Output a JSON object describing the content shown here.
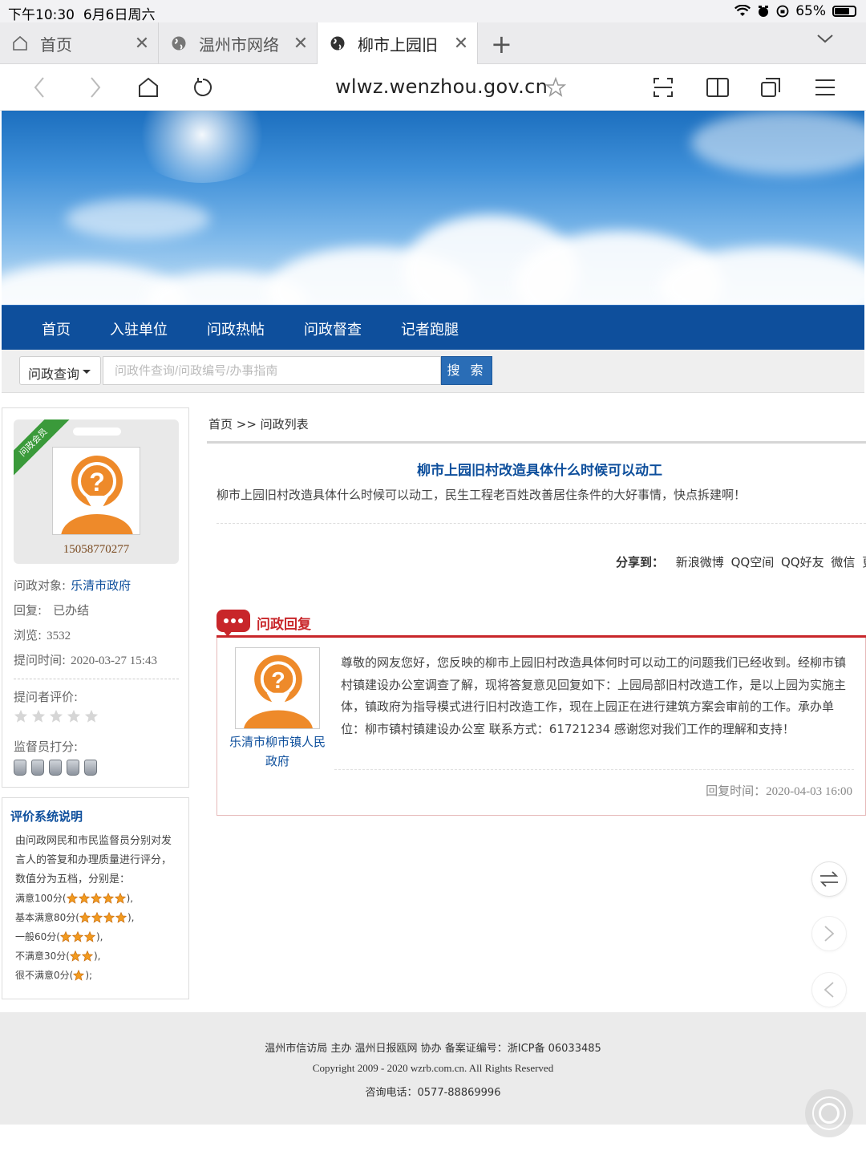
{
  "status_bar": {
    "time": "下午10:30",
    "date": "6月6日周六",
    "battery": "65%"
  },
  "tabs": [
    {
      "label": "首页",
      "icon": "home-icon",
      "active": false
    },
    {
      "label": "温州市网络",
      "icon": "globe-icon",
      "active": false
    },
    {
      "label": "柳市上园旧",
      "icon": "globe-icon",
      "active": true
    }
  ],
  "address": {
    "url": "wlwz.wenzhou.gov.cn"
  },
  "main_nav": [
    "首页",
    "入驻单位",
    "问政热帖",
    "问政督查",
    "记者跑腿"
  ],
  "search": {
    "select": "问政查询",
    "placeholder": "问政件查询/问政编号/办事指南",
    "button": "搜 索"
  },
  "asker": {
    "ribbon": "问政会员",
    "phone": "15058770277",
    "target_label": "问政对象:",
    "target_value": "乐清市政府",
    "reply_label": "回复:",
    "reply_value": "已办结",
    "views_label": "浏览:",
    "views_value": "3532",
    "time_label": "提问时间:",
    "time_value": "2020-03-27 15:43",
    "asker_rating_label": "提问者评价:",
    "supervisor_label": "监督员打分:"
  },
  "rules": {
    "title": "评价系统说明",
    "desc": "由问政网民和市民监督员分别对发言人的答复和办理质量进行评分，数值分为五档，分别是：",
    "levels": [
      {
        "label": "满意100分(",
        "stars": 5,
        "suffix": "),"
      },
      {
        "label": "基本满意80分(",
        "stars": 4,
        "suffix": "),"
      },
      {
        "label": "一般60分(",
        "stars": 3,
        "suffix": "),"
      },
      {
        "label": "不满意30分(",
        "stars": 2,
        "suffix": "),"
      },
      {
        "label": "很不满意0分(",
        "stars": 1,
        "suffix": ");"
      }
    ]
  },
  "content": {
    "breadcrumb": "首页 >> 问政列表",
    "title": "柳市上园旧村改造具体什么时候可以动工",
    "body": "柳市上园旧村改造具体什么时候可以动工，民生工程老百姓改善居住条件的大好事情，快点拆建啊！",
    "share_label": "分享到：",
    "share_items": [
      "新浪微博",
      "QQ空间",
      "QQ好友",
      "微信",
      "更多"
    ]
  },
  "reply": {
    "header": "问政回复",
    "org": "乐清市柳市镇人民政府",
    "text": "尊敬的网友您好，您反映的柳市上园旧村改造具体何时可以动工的问题我们已经收到。经柳市镇村镇建设办公室调查了解，现将答复意见回复如下：上园局部旧村改造工作，是以上园为实施主体，镇政府为指导模式进行旧村改造工作，现在上园正在进行建筑方案会审前的工作。承办单位：柳市镇村镇建设办公室 联系方式：61721234 感谢您对我们工作的理解和支持！",
    "time_label": "回复时间：",
    "time_value": "2020-04-03 16:00"
  },
  "footer": {
    "line1": "温州市信访局 主办 温州日报瓯网 协办 备案证编号：浙ICP备 06033485",
    "line2": "Copyright 2009 - 2020 wzrb.com.cn. All Rights Reserved",
    "line3": "咨询电话：0577-88869996"
  }
}
